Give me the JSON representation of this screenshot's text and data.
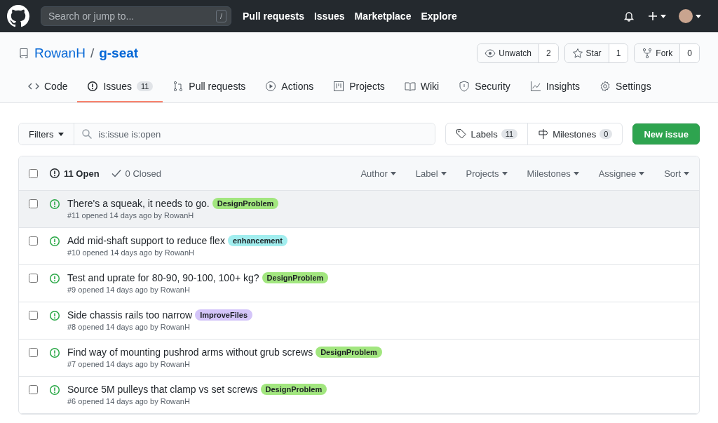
{
  "topbar": {
    "search": {
      "placeholder": "Search or jump to...",
      "shortcut": "/"
    },
    "links": [
      "Pull requests",
      "Issues",
      "Marketplace",
      "Explore"
    ]
  },
  "repo": {
    "owner": "RowanH",
    "separator": "/",
    "name": "g-seat",
    "actions": [
      {
        "label": "Unwatch",
        "count": "2",
        "kind": "eye"
      },
      {
        "label": "Star",
        "count": "1",
        "kind": "star"
      },
      {
        "label": "Fork",
        "count": "0",
        "kind": "fork"
      }
    ]
  },
  "tabs": [
    {
      "label": "Code",
      "kind": "code",
      "selected": false
    },
    {
      "label": "Issues",
      "count": "11",
      "kind": "issue",
      "selected": true
    },
    {
      "label": "Pull requests",
      "kind": "pr",
      "selected": false
    },
    {
      "label": "Actions",
      "kind": "play",
      "selected": false
    },
    {
      "label": "Projects",
      "kind": "project",
      "selected": false
    },
    {
      "label": "Wiki",
      "kind": "book",
      "selected": false
    },
    {
      "label": "Security",
      "kind": "shield",
      "selected": false
    },
    {
      "label": "Insights",
      "kind": "graph",
      "selected": false
    },
    {
      "label": "Settings",
      "kind": "gear",
      "selected": false
    }
  ],
  "filters": {
    "button": "Filters",
    "query": "is:issue is:open",
    "labels": {
      "label": "Labels",
      "count": "11"
    },
    "milestones": {
      "label": "Milestones",
      "count": "0"
    },
    "new_issue": "New issue"
  },
  "list_header": {
    "select_all_checked": false,
    "open": "11 Open",
    "closed": "0 Closed",
    "menus": [
      "Author",
      "Label",
      "Projects",
      "Milestones",
      "Assignee",
      "Sort"
    ]
  },
  "issues": [
    {
      "title": "There's a squeak, it needs to go.",
      "label": "DesignProblem",
      "color": "#a2e67f",
      "meta": "#11 opened 14 days ago by RowanH",
      "highlighted": true,
      "checked": false
    },
    {
      "title": "Add mid-shaft support to reduce flex",
      "label": "enhancement",
      "color": "#a2eeef",
      "meta": "#10 opened 14 days ago by RowanH",
      "highlighted": false,
      "checked": false
    },
    {
      "title": "Test and uprate for 80-90, 90-100, 100+ kg?",
      "label": "DesignProblem",
      "color": "#a2e67f",
      "meta": "#9 opened 14 days ago by RowanH",
      "highlighted": false,
      "checked": false
    },
    {
      "title": "Side chassis rails too narrow",
      "label": "ImproveFiles",
      "color": "#d4c5f9",
      "meta": "#8 opened 14 days ago by RowanH",
      "highlighted": false,
      "checked": false
    },
    {
      "title": "Find way of mounting pushrod arms without grub screws",
      "label": "DesignProblem",
      "color": "#a2e67f",
      "meta": "#7 opened 14 days ago by RowanH",
      "highlighted": false,
      "checked": false
    },
    {
      "title": "Source 5M pulleys that clamp vs set screws",
      "label": "DesignProblem",
      "color": "#a2e67f",
      "meta": "#6 opened 14 days ago by RowanH",
      "highlighted": false,
      "checked": false
    }
  ]
}
